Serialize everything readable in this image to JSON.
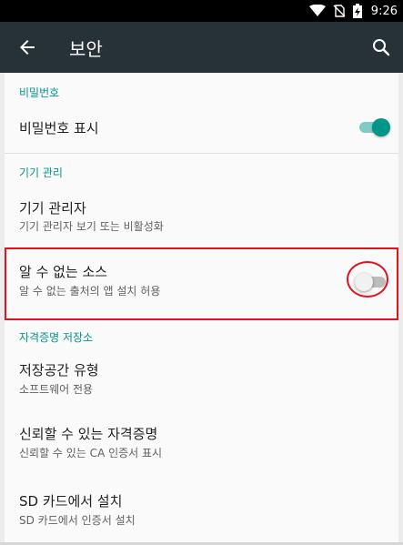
{
  "status_bar": {
    "time": "9:26",
    "icons": [
      "wifi-icon",
      "no-sim-icon",
      "battery-charging-icon"
    ]
  },
  "toolbar": {
    "title": "보안",
    "back_icon": "arrow-back-icon",
    "search_icon": "search-icon",
    "background": "#263238"
  },
  "sections": {
    "password": {
      "header": "비밀번호",
      "show_password": {
        "title": "비밀번호 표시",
        "enabled": true
      }
    },
    "device_admin": {
      "header": "기기 관리",
      "device_administrators": {
        "title": "기기 관리자",
        "summary": "기기 관리자 보기 또는 비활성화"
      },
      "unknown_sources": {
        "title": "알 수 없는 소스",
        "summary": "알 수 없는 출처의 앱 설치 허용",
        "enabled": false
      }
    },
    "credential_storage": {
      "header": "자격증명 저장소",
      "storage_type": {
        "title": "저장공간 유형",
        "summary": "소프트웨어 전용"
      },
      "trusted_credentials": {
        "title": "신뢰할 수 있는 자격증명",
        "summary": "신뢰할 수 있는 CA 인증서 표시"
      },
      "install_from_sd": {
        "title": "SD 카드에서 설치",
        "summary": "SD 카드에서 인증서 설치"
      }
    }
  },
  "colors": {
    "accent": "#009688",
    "highlight": "#e0141e"
  }
}
